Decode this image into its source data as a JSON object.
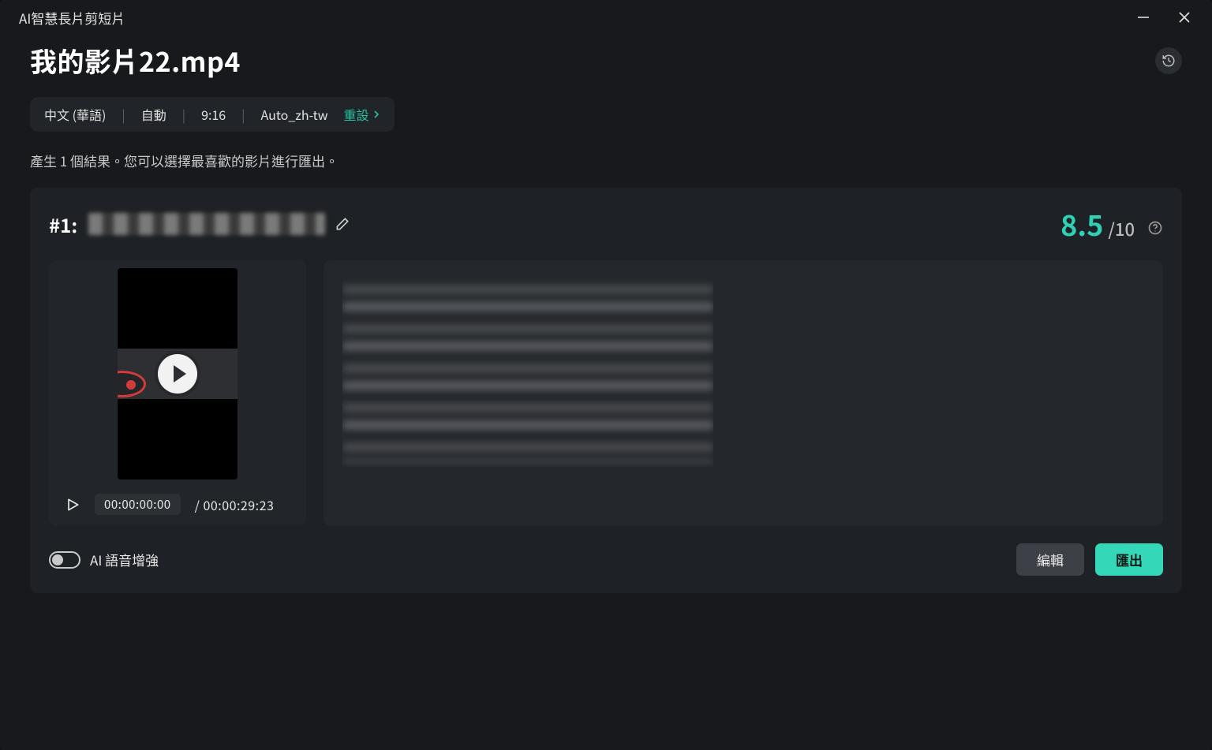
{
  "window": {
    "title": "AI智慧長片剪短片"
  },
  "header": {
    "file_title": "我的影片22.mp4",
    "meta": {
      "language": "中文 (華語)",
      "mode": "自動",
      "duration": "9:16",
      "preset": "Auto_zh-tw",
      "reset_label": "重設"
    },
    "hint": "產生 1 個結果。您可以選擇最喜歡的影片進行匯出。"
  },
  "result": {
    "index_label": "#1:",
    "score_value": "8.5",
    "score_max": "/10",
    "time_current": "00:00:00:00",
    "time_duration": "/  00:00:29:23",
    "ai_voice_toggle_label": "AI 語音增強",
    "btn_edit": "編輯",
    "btn_export": "匯出"
  }
}
